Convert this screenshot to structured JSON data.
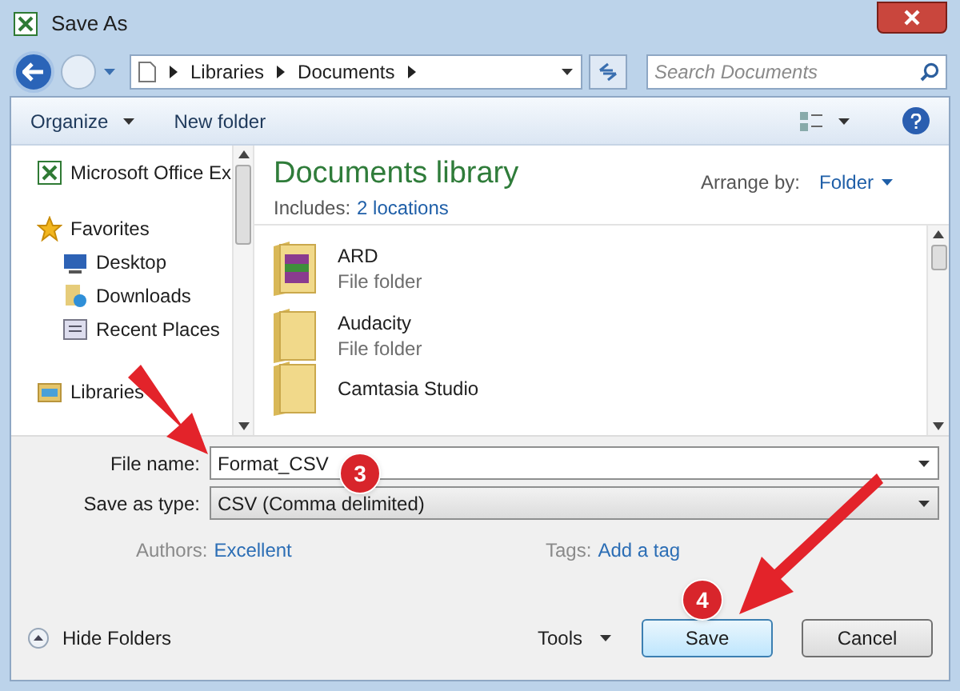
{
  "window": {
    "title": "Save As"
  },
  "address": {
    "crumbs": [
      "Libraries",
      "Documents"
    ],
    "search_placeholder": "Search Documents"
  },
  "toolbar": {
    "organize": "Organize",
    "new_folder": "New folder"
  },
  "sidebar": {
    "items": [
      {
        "kind": "group",
        "label": "Microsoft Office Ex"
      },
      {
        "kind": "group",
        "label": "Favorites"
      },
      {
        "kind": "item",
        "label": "Desktop"
      },
      {
        "kind": "item",
        "label": "Downloads"
      },
      {
        "kind": "item",
        "label": "Recent Places"
      },
      {
        "kind": "group",
        "label": "Libraries"
      }
    ]
  },
  "library": {
    "title": "Documents library",
    "includes_label": "Includes:",
    "includes_link": "2 locations",
    "arrange_label": "Arrange by:",
    "arrange_value": "Folder"
  },
  "files": [
    {
      "name": "ARD",
      "type": "File folder"
    },
    {
      "name": "Audacity",
      "type": "File folder"
    },
    {
      "name": "Camtasia Studio"
    }
  ],
  "form": {
    "file_name_label": "File name:",
    "file_name": "Format_CSV",
    "type_label": "Save as type:",
    "type_value": "CSV (Comma delimited)",
    "authors_label": "Authors:",
    "authors_value": "Excellent",
    "tags_label": "Tags:",
    "tags_value": "Add a tag"
  },
  "footer": {
    "hide_folders": "Hide Folders",
    "tools": "Tools",
    "save": "Save",
    "cancel": "Cancel"
  },
  "annotations": [
    {
      "label": "3"
    },
    {
      "label": "4"
    }
  ]
}
